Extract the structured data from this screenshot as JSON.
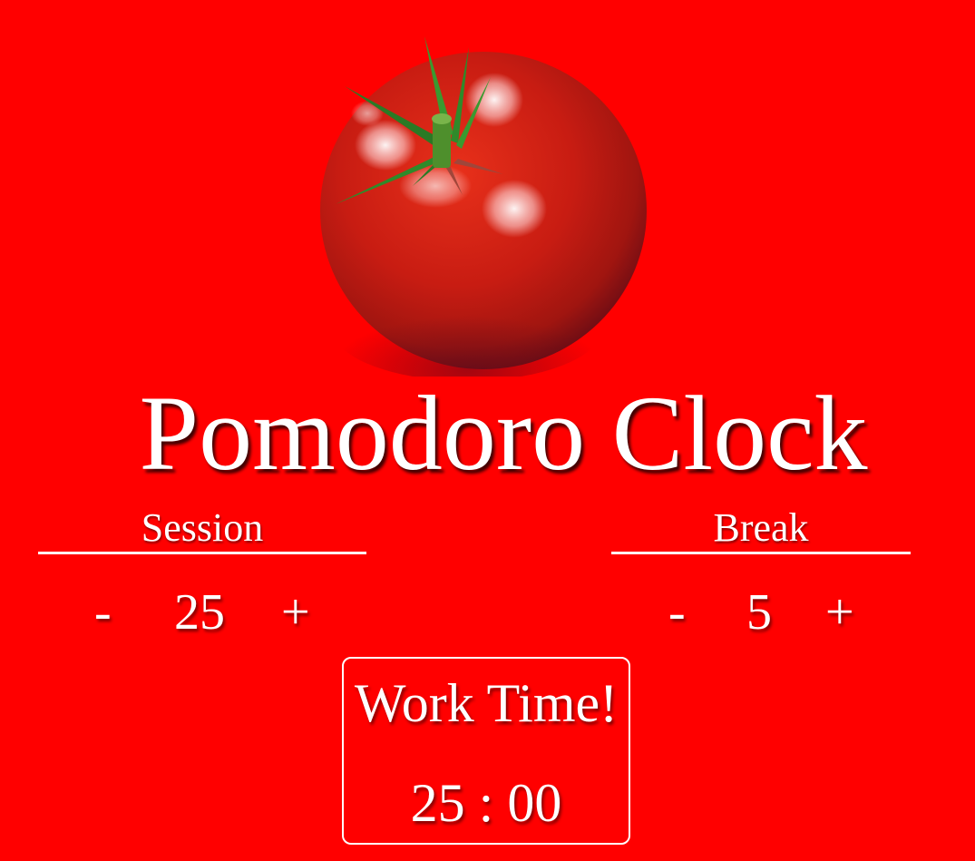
{
  "title": "Pomodoro Clock",
  "session": {
    "label": "Session",
    "decrement": "-",
    "value": "25",
    "increment": "+"
  },
  "break": {
    "label": "Break",
    "decrement": "-",
    "value": "5",
    "increment": "+"
  },
  "timer": {
    "label": "Work Time!",
    "value": "25 : 00"
  },
  "colors": {
    "background": "#ff0000",
    "text": "#ffffff"
  },
  "icons": {
    "logo": "tomato-icon"
  }
}
